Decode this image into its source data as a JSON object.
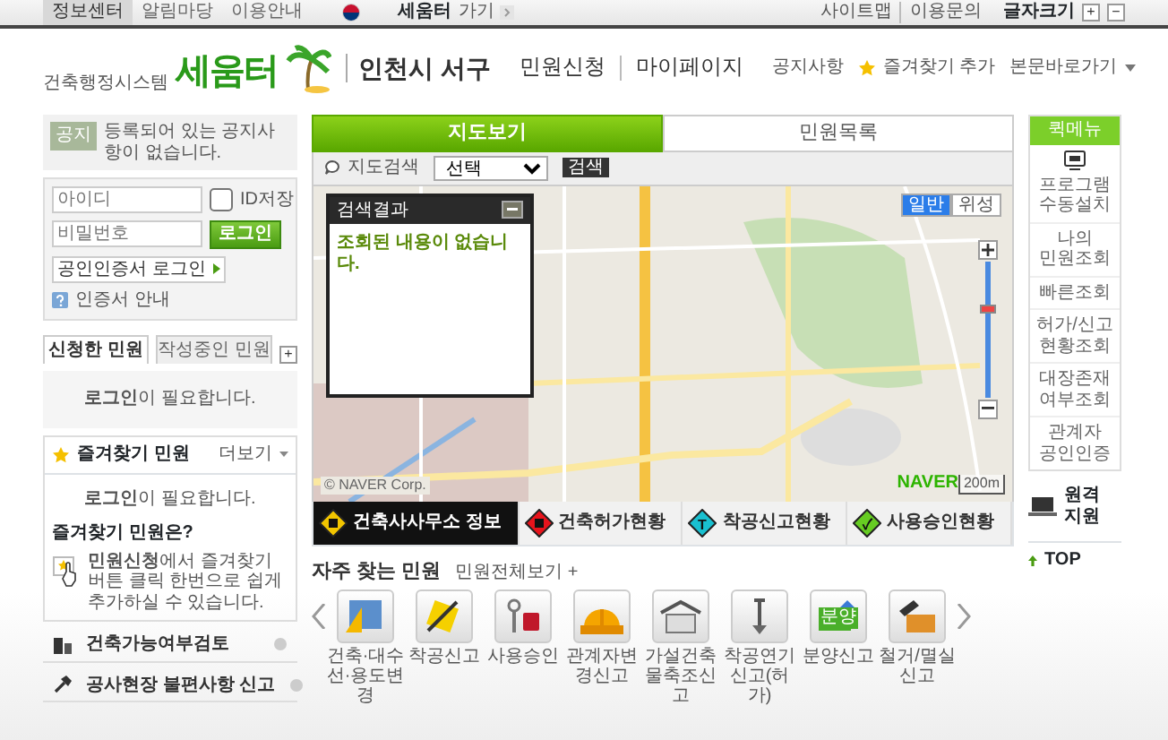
{
  "top_bar": {
    "menu": [
      {
        "label": "정보센터",
        "selected": true
      },
      {
        "label": "알림마당",
        "selected": false
      },
      {
        "label": "이용안내",
        "selected": false
      }
    ],
    "site_link": "세움터",
    "site_link_suffix": "가기",
    "utility": [
      "사이트맵",
      "이용문의"
    ],
    "font_size_label": "글자크기",
    "font_size_buttons": [
      "+",
      "−"
    ]
  },
  "header": {
    "logo": {
      "name": "세움터",
      "subtitle": "건축행정시스템"
    },
    "region": "인천시 서구",
    "nav": [
      "민원신청",
      "마이페이지"
    ],
    "links": [
      {
        "label": "공지사항",
        "kind": "plain"
      },
      {
        "label": "즐겨찾기 추가",
        "kind": "star"
      },
      {
        "label": "본문바로가기",
        "kind": "dropdown"
      }
    ]
  },
  "notice": {
    "badge": "공지",
    "text": "등록되어 있는 공지사항이 없습니다."
  },
  "login": {
    "id_placeholder": "아이디",
    "pw_placeholder": "비밀번호",
    "save_id": {
      "label": "ID저장",
      "checked": false
    },
    "button": "로그인",
    "cert_button": "공인인증서 로그인",
    "cert_guide": "인증서 안내"
  },
  "my_tabs": {
    "tabs": [
      {
        "label": "신청한 민원",
        "selected": true
      },
      {
        "label": "작성중인 민원",
        "selected": false
      }
    ],
    "add": "+",
    "message": "**로그인**이 필요합니다."
  },
  "favorites": {
    "title": "즐겨찾기 민원",
    "more": "더보기",
    "message": "**로그인**이 필요합니다.",
    "help_title": "즐겨찾기 민원은?",
    "help_text": "**민원신청**에서 즐겨찾기버튼 클릭 한번으로 쉽게 추가하실 수 있습니다."
  },
  "shortcuts": [
    {
      "label": "건축가능여부검토"
    },
    {
      "label": "공사현장 불편사항 신고"
    }
  ],
  "main_tabs": [
    {
      "label": "지도보기",
      "selected": true
    },
    {
      "label": "민원목록",
      "selected": false
    }
  ],
  "map_search": {
    "label": "지도검색",
    "select": "선택",
    "button": "검색"
  },
  "map": {
    "types": [
      {
        "label": "일반",
        "selected": true
      },
      {
        "label": "위성",
        "selected": false
      }
    ],
    "zoom": {
      "level": 0.65
    },
    "copyright": "© NAVER Corp.",
    "brand": "NAVER",
    "scale": "200m",
    "result_panel": {
      "title": "검색결과",
      "message": "조회된 내용이 없습니다."
    }
  },
  "categories": [
    {
      "label": "건축사사무소 정보",
      "selected": true,
      "color": "#f2c500"
    },
    {
      "label": "건축허가현황",
      "selected": false,
      "color": "#e8141c"
    },
    {
      "label": "착공신고현황",
      "selected": false,
      "color": "#19c0d0",
      "symbol": "T"
    },
    {
      "label": "사용승인현황",
      "selected": false,
      "color": "#66cc22",
      "symbol": "✓"
    }
  ],
  "frequent": {
    "title": "자주 찾는 민원",
    "all_link": "민원전체보기 +",
    "items": [
      {
        "label": "건축·대수선·용도변경"
      },
      {
        "label": "착공신고"
      },
      {
        "label": "사용승인"
      },
      {
        "label": "관계자변경신고"
      },
      {
        "label": "가설건축물축조신고"
      },
      {
        "label": "착공연기신고(허가)"
      },
      {
        "label": "분양신고",
        "badge": "분양"
      },
      {
        "label": "철거/멸실신고"
      }
    ]
  },
  "quick_menu": {
    "title": "퀵메뉴",
    "items": [
      "프로그램 수동설치",
      "나의 민원조회",
      "빠른조회",
      "허가/신고 현황조회",
      "대장존재 여부조회",
      "관계자 공인인증"
    ],
    "remote": "원격 지원",
    "top": "TOP"
  }
}
